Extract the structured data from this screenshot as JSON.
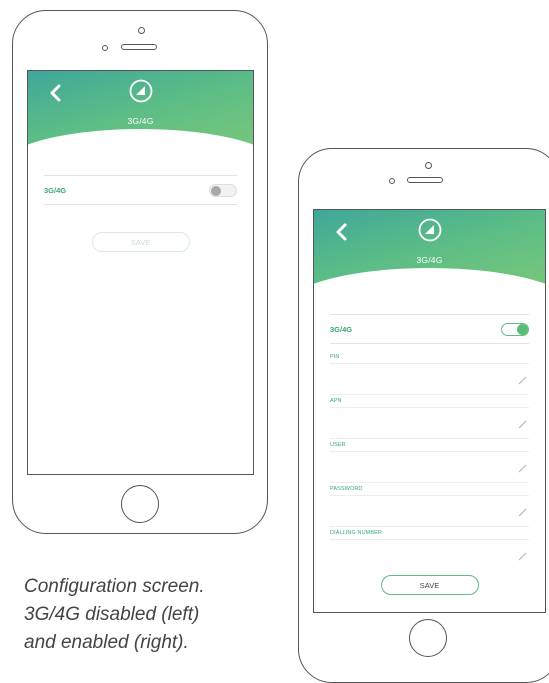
{
  "left_screen": {
    "title": "3G/4G",
    "toggle_label": "3G/4G",
    "toggle_state": "off",
    "save_label": "SAVE"
  },
  "right_screen": {
    "title": "3G/4G",
    "toggle_label": "3G/4G",
    "toggle_state": "on",
    "save_label": "SAVE",
    "fields": [
      {
        "label": "PIN",
        "value": ""
      },
      {
        "label": "APN",
        "value": ""
      },
      {
        "label": "USER",
        "value": ""
      },
      {
        "label": "PASSWORD",
        "value": ""
      },
      {
        "label": "DIALLING NUMBER",
        "value": ""
      }
    ]
  },
  "caption": {
    "line1": "Configuration screen.",
    "line2": "3G/4G disabled (left)",
    "line3": "and enabled (right)."
  },
  "colors": {
    "header_start": "#3fa79a",
    "header_end": "#78c77b",
    "accent": "#5cbd7a",
    "label_green": "#3aa674"
  },
  "icons": {
    "back": "chevron-left-icon",
    "logo": "circle-triangle-icon",
    "edit": "pencil-icon"
  }
}
